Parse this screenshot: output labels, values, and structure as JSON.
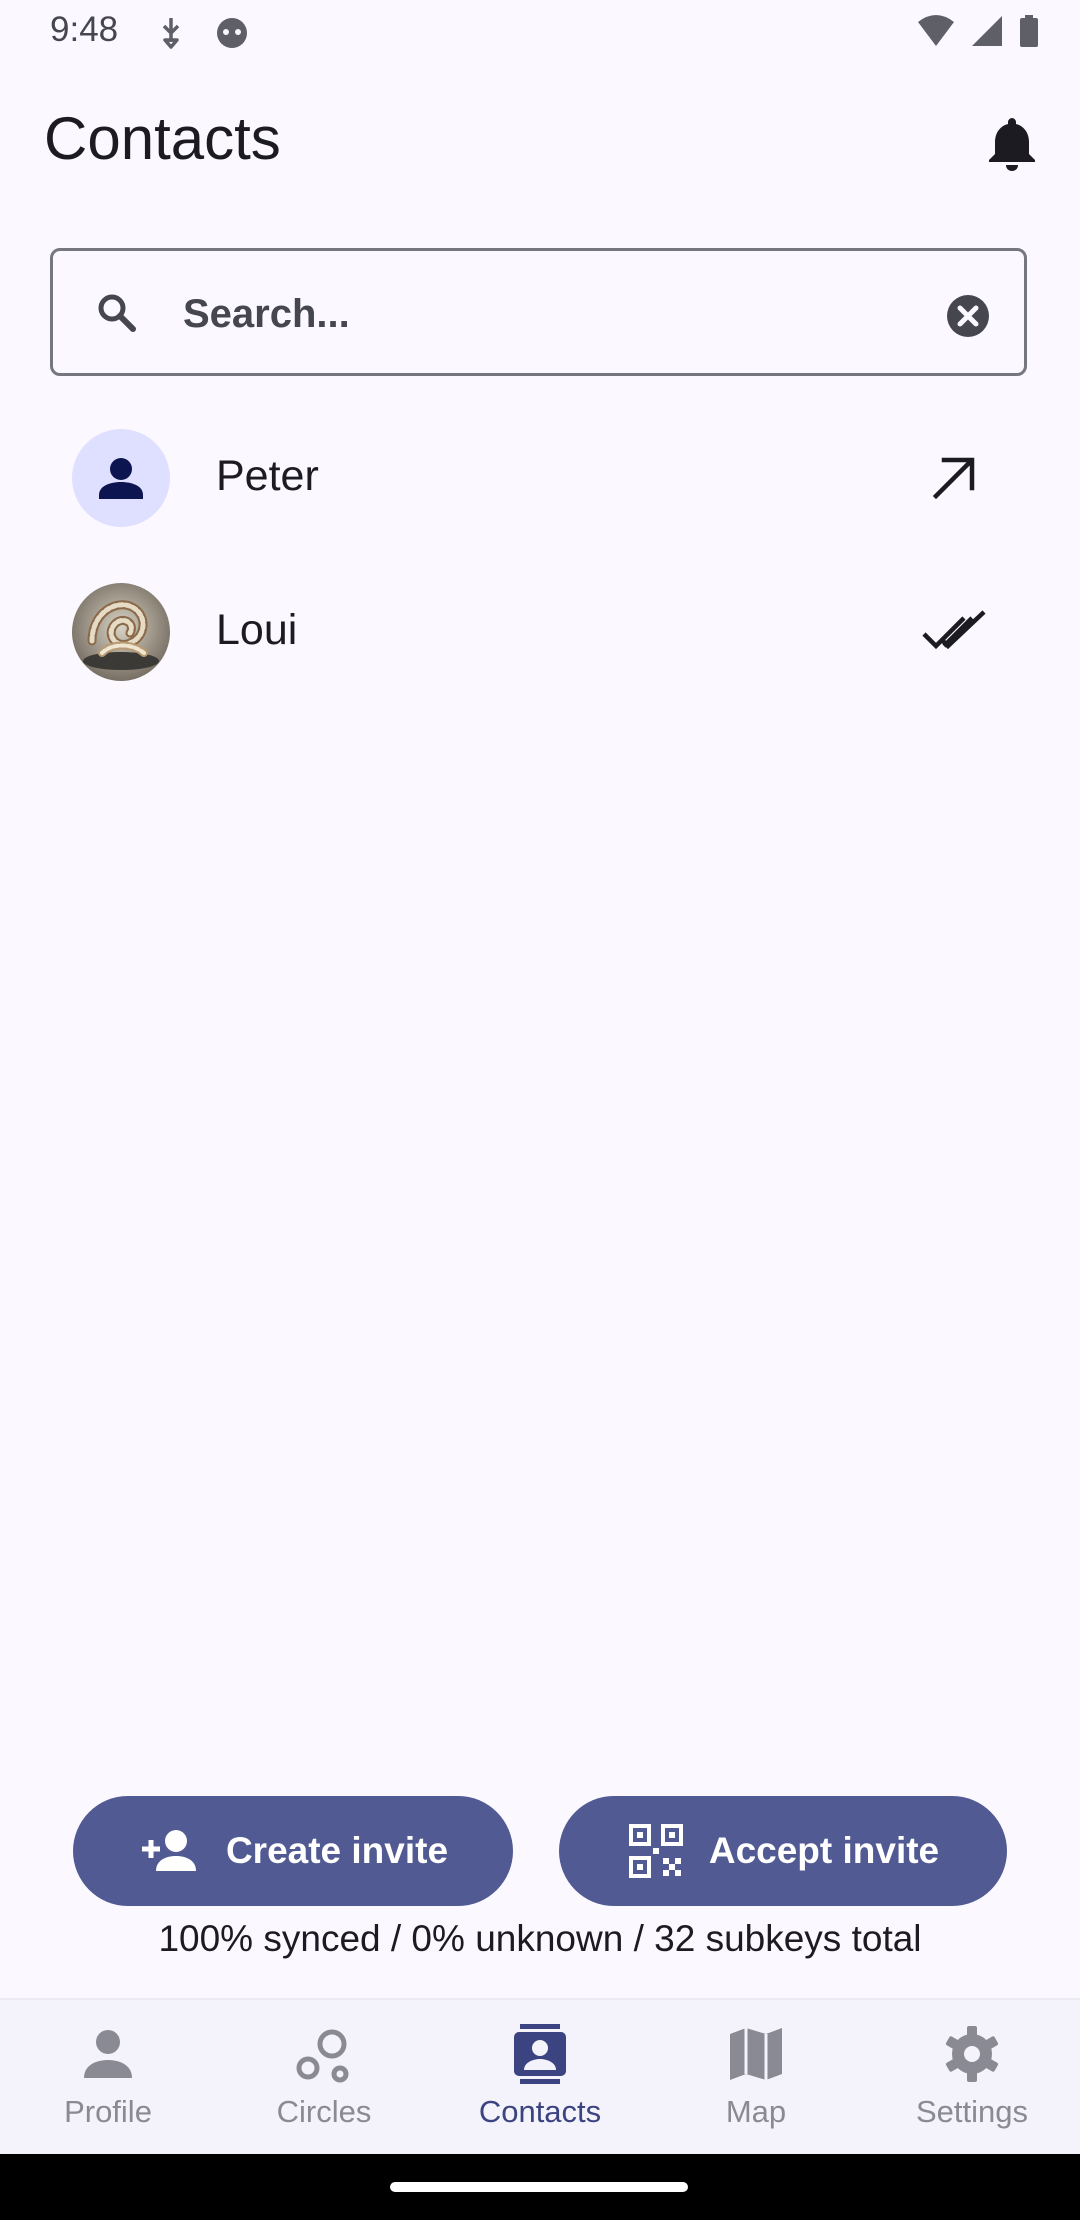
{
  "status_bar": {
    "time": "9:48"
  },
  "header": {
    "title": "Contacts",
    "notification_icon": "bell-icon"
  },
  "search": {
    "placeholder": "Search...",
    "value": ""
  },
  "contacts": [
    {
      "name": "Peter",
      "avatar": "default-person-icon",
      "status_icon": "arrow-up-right-icon"
    },
    {
      "name": "Loui",
      "avatar": "rope-knot-photo",
      "status_icon": "double-check-icon"
    }
  ],
  "actions": {
    "create_invite": "Create invite",
    "accept_invite": "Accept invite"
  },
  "sync_status": "100% synced / 0% unknown / 32 subkeys total",
  "bottom_nav": {
    "items": [
      {
        "label": "Profile",
        "icon": "person-icon"
      },
      {
        "label": "Circles",
        "icon": "circles-icon"
      },
      {
        "label": "Contacts",
        "icon": "contact-card-icon",
        "active": true
      },
      {
        "label": "Map",
        "icon": "map-icon"
      },
      {
        "label": "Settings",
        "icon": "gear-icon"
      }
    ]
  },
  "colors": {
    "background": "#fbf8ff",
    "primary_button": "#515a92",
    "active_nav": "#3b4480",
    "inactive_nav": "#8a8a95",
    "avatar_bg": "#dfe0ff"
  }
}
